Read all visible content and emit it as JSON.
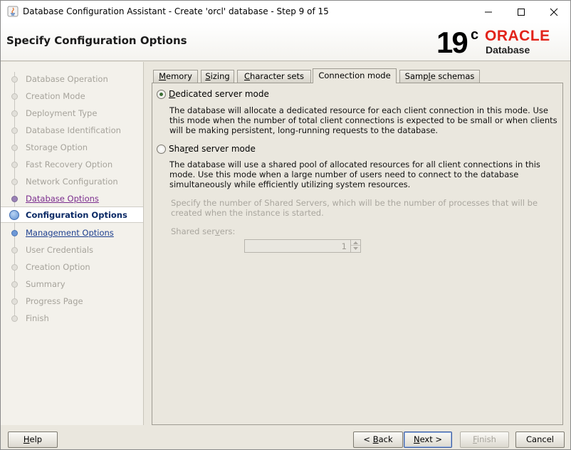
{
  "window": {
    "title": "Database Configuration Assistant - Create 'orcl' database - Step 9 of 15",
    "controls": [
      "minimize",
      "maximize",
      "close"
    ]
  },
  "header": {
    "page_title": "Specify Configuration Options",
    "logo": {
      "version": "19",
      "version_sup": "c",
      "brand": "ORACLE",
      "product": "Database"
    }
  },
  "steps": [
    {
      "label": "Database Operation",
      "state": "done"
    },
    {
      "label": "Creation Mode",
      "state": "done"
    },
    {
      "label": "Deployment Type",
      "state": "done"
    },
    {
      "label": "Database Identification",
      "state": "done"
    },
    {
      "label": "Storage Option",
      "state": "done"
    },
    {
      "label": "Fast Recovery Option",
      "state": "done"
    },
    {
      "label": "Network Configuration",
      "state": "done"
    },
    {
      "label": "Database Options",
      "state": "visited"
    },
    {
      "label": "Configuration Options",
      "state": "current"
    },
    {
      "label": "Management Options",
      "state": "link"
    },
    {
      "label": "User Credentials",
      "state": "pending"
    },
    {
      "label": "Creation Option",
      "state": "pending"
    },
    {
      "label": "Summary",
      "state": "pending"
    },
    {
      "label": "Progress Page",
      "state": "pending"
    },
    {
      "label": "Finish",
      "state": "pending"
    }
  ],
  "tabs": [
    {
      "pre": "",
      "mn": "M",
      "post": "emory"
    },
    {
      "pre": "",
      "mn": "S",
      "post": "izing"
    },
    {
      "pre": "",
      "mn": "C",
      "post": "haracter sets"
    },
    {
      "pre": "Connection mode",
      "mn": "",
      "post": "",
      "selected": true
    },
    {
      "pre": "Samp",
      "mn": "l",
      "post": "e schemas"
    }
  ],
  "connection": {
    "dedicated": {
      "pre": "",
      "mn": "D",
      "post": "edicated server mode",
      "selected": true,
      "description": "The database will allocate a dedicated resource for each client connection in this mode. Use this mode when the number of total client connections is expected to be small or when clients will be making persistent, long-running requests to the database."
    },
    "shared": {
      "pre": "Sha",
      "mn": "r",
      "post": "ed server mode",
      "selected": false,
      "description": "The database will use a shared pool of allocated resources for all client connections in this mode.  Use this mode when a large number of users need to connect to the database simultaneously while efficiently utilizing system resources."
    },
    "shared_servers_note": "Specify the number of Shared Servers, which will be the number of processes that will be created when the instance is started.",
    "shared_servers_label": {
      "pre": "Shared ser",
      "mn": "v",
      "post": "ers:"
    },
    "shared_servers_value": "1"
  },
  "buttons": {
    "help": {
      "pre": "",
      "mn": "H",
      "post": "elp"
    },
    "back": {
      "pre": "< ",
      "mn": "B",
      "post": "ack"
    },
    "next": {
      "pre": "",
      "mn": "N",
      "post": "ext >"
    },
    "finish": {
      "pre": "",
      "mn": "F",
      "post": "inish"
    },
    "cancel": {
      "pre": "Cancel",
      "mn": "",
      "post": ""
    }
  },
  "colors": {
    "accent_blue": "#1d3f8f",
    "visited_purple": "#7b2d8e",
    "oracle_red": "#e2231a",
    "panel_bg": "#eae7de"
  }
}
